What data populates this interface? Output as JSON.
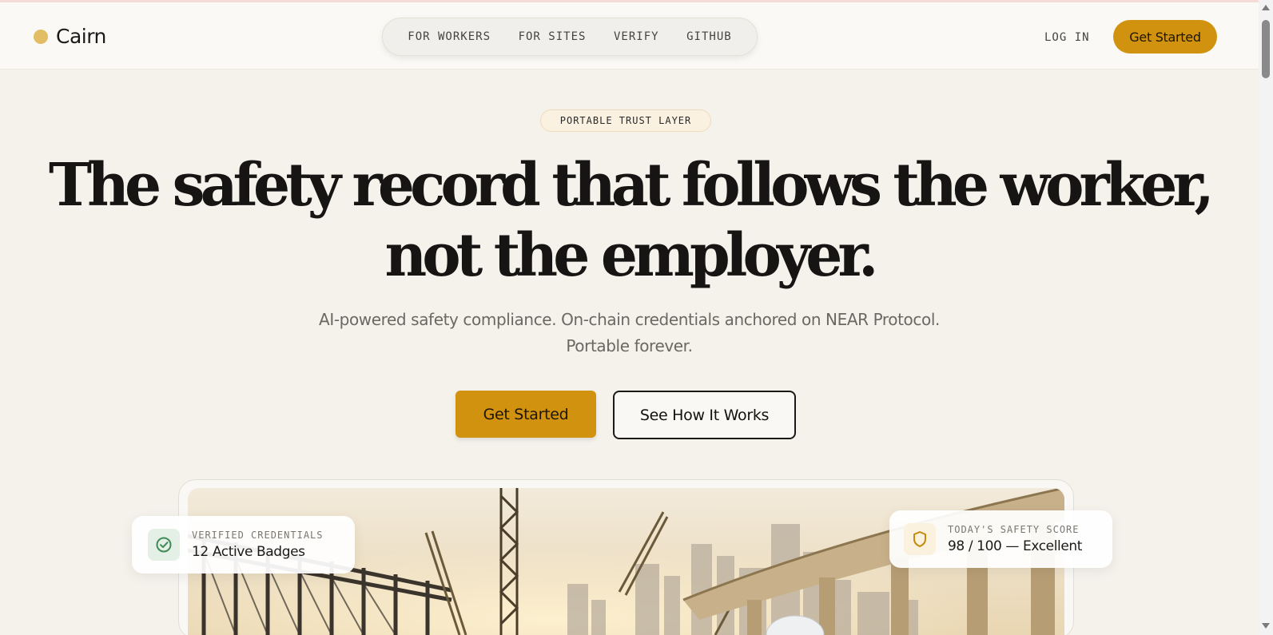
{
  "header": {
    "brand": "Cairn",
    "nav": [
      "FOR WORKERS",
      "FOR SITES",
      "VERIFY",
      "GITHUB"
    ],
    "login": "LOG IN",
    "cta": "Get Started"
  },
  "hero": {
    "eyebrow": "PORTABLE TRUST LAYER",
    "headline_line1": "The safety record that follows the worker,",
    "headline_line2": "not the employer.",
    "sub_line1": "AI-powered safety compliance. On-chain credentials anchored on NEAR Protocol.",
    "sub_line2": "Portable forever.",
    "primary_cta": "Get Started",
    "secondary_cta": "See How It Works"
  },
  "cards": {
    "credentials": {
      "label": "VERIFIED CREDENTIALS",
      "value": "12 Active Badges",
      "icon": "check-circle-icon"
    },
    "score": {
      "label": "TODAY'S SAFETY SCORE",
      "value": "98 / 100 — Excellent",
      "icon": "shield-icon"
    }
  },
  "colors": {
    "accent": "#d1930f",
    "brand_dot": "#e3bd64",
    "background": "#f5f2ec"
  }
}
